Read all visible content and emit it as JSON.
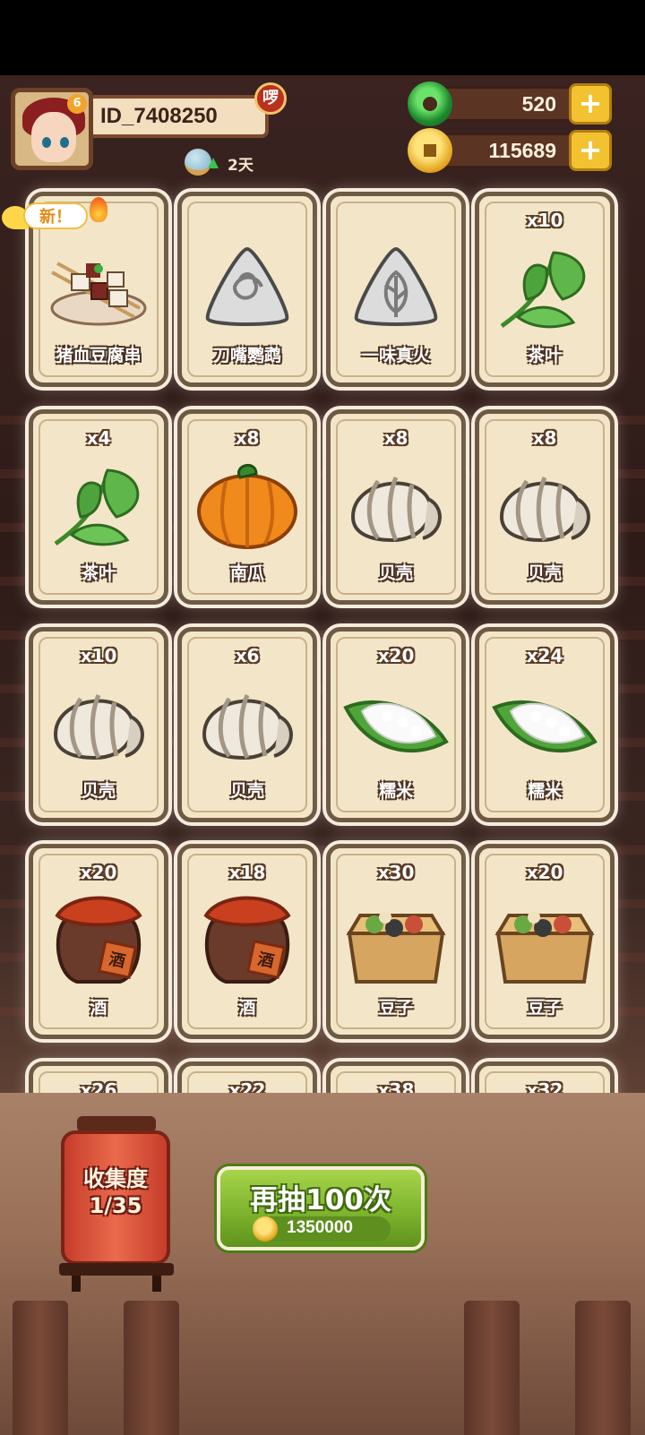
{
  "player": {
    "id": "ID_7408250",
    "title_badge": "啰",
    "level_badge": "6",
    "streak": "2天"
  },
  "currencies": {
    "jade": "520",
    "coins": "115689"
  },
  "new_tag": "新！",
  "cards": [
    {
      "qty": "",
      "name": "猪血豆腐串",
      "icon": "tofu-skewer-icon",
      "is_new": true
    },
    {
      "qty": "",
      "name": "刀嘴鹦鹉",
      "icon": "swirl-stone-icon",
      "is_new": false
    },
    {
      "qty": "",
      "name": "一味真火",
      "icon": "leaf-stone-icon",
      "is_new": false
    },
    {
      "qty": "x10",
      "name": "茶叶",
      "icon": "tea-leaf-icon"
    },
    {
      "qty": "x4",
      "name": "茶叶",
      "icon": "tea-leaf-icon"
    },
    {
      "qty": "x8",
      "name": "南瓜",
      "icon": "pumpkin-icon"
    },
    {
      "qty": "x8",
      "name": "贝壳",
      "icon": "clam-icon"
    },
    {
      "qty": "x8",
      "name": "贝壳",
      "icon": "clam-icon"
    },
    {
      "qty": "x10",
      "name": "贝壳",
      "icon": "clam-icon"
    },
    {
      "qty": "x6",
      "name": "贝壳",
      "icon": "clam-icon"
    },
    {
      "qty": "x20",
      "name": "糯米",
      "icon": "rice-leaf-icon"
    },
    {
      "qty": "x24",
      "name": "糯米",
      "icon": "rice-leaf-icon"
    },
    {
      "qty": "x20",
      "name": "酒",
      "icon": "wine-jar-icon",
      "jar_label": "酒"
    },
    {
      "qty": "x18",
      "name": "酒",
      "icon": "wine-jar-icon",
      "jar_label": "酒"
    },
    {
      "qty": "x30",
      "name": "豆子",
      "icon": "bean-box-icon"
    },
    {
      "qty": "x20",
      "name": "豆子",
      "icon": "bean-box-icon"
    },
    {
      "qty": "x26",
      "name": "",
      "icon": ""
    },
    {
      "qty": "x22",
      "name": "",
      "icon": ""
    },
    {
      "qty": "x38",
      "name": "",
      "icon": ""
    },
    {
      "qty": "x32",
      "name": "",
      "icon": ""
    }
  ],
  "collection": {
    "label": "收集度",
    "progress": "1/35"
  },
  "draw_button": {
    "label": "再抽100次",
    "cost": "1350000"
  }
}
